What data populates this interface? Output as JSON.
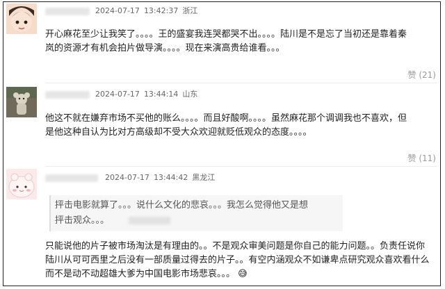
{
  "comments": [
    {
      "date": "2024-07-17",
      "time": "13:42:37",
      "location": "浙江",
      "lines": [
        "开心麻花至少让我笑了。。。。王的盛宴我连哭都哭不出。。。。陆川是不是忘了当初还是靠着秦",
        "岚的资源才有机会拍片做导演。。。。现在来演高贵给谁看。。。"
      ],
      "like_label": "赞",
      "like_count": "(21)"
    },
    {
      "date": "2024-07-17",
      "time": "13:44:14",
      "location": "山东",
      "lines": [
        "他这不就在嫌弃市场不买他的账么。。。。而且好酸啊。。。。虽然麻花那个调调我也不喜欢，但",
        "是他这种自认为比对方高级却不受大众欢迎就贬低观众的态度。。。。"
      ],
      "like_label": "赞",
      "like_count": "(11)"
    },
    {
      "date": "2024-07-17",
      "time": "13:44:42",
      "location": "黑龙江",
      "quote_lines": [
        "抨击电影就算了。。。说什么文化的悲哀。。。我怎么觉得他又是想",
        "抨击观众。。。"
      ],
      "lines": [
        "只能说他的片子被市场淘汰是有理由的。。不是观众审美问题是你自己的能力问题。。负责任说你",
        "陆川从可可西里之后没有一部质量过得去的片子。。有空内涵观众不如谦卑点研究观众喜欢看什么",
        "而不是动不动超雄大爹为中国电影市场悲哀。。。"
      ],
      "emoji": "😅"
    }
  ],
  "colors": {
    "meta": "#666666",
    "like": "#999999",
    "text": "#222222"
  }
}
